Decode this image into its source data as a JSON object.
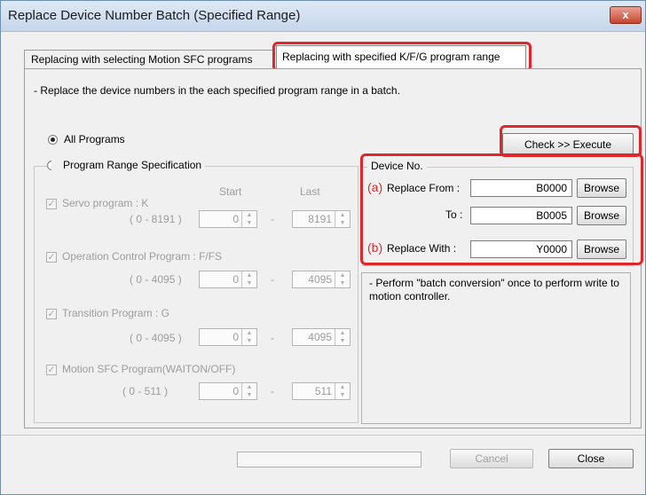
{
  "window": {
    "title": "Replace Device Number Batch (Specified Range)",
    "close_glyph": "x"
  },
  "tabs": [
    {
      "label": "Replacing with selecting Motion SFC programs"
    },
    {
      "label": "Replacing with specified K/F/G program range"
    }
  ],
  "description": "- Replace the device numbers in the each specified program range in a batch.",
  "options": {
    "all_programs": "All Programs",
    "range_spec": "Program Range Specification"
  },
  "range": {
    "start_header": "Start",
    "last_header": "Last",
    "dash": "-",
    "items": [
      {
        "label": "Servo program : K",
        "range": "( 0 - 8191 )",
        "start": "0",
        "last": "8191"
      },
      {
        "label": "Operation Control Program : F/FS",
        "range": "( 0 - 4095 )",
        "start": "0",
        "last": "4095"
      },
      {
        "label": "Transition Program : G",
        "range": "( 0 - 4095 )",
        "start": "0",
        "last": "4095"
      },
      {
        "label": "Motion SFC Program(WAITON/OFF)",
        "range": "( 0 - 511 )",
        "start": "0",
        "last": "511"
      }
    ]
  },
  "execute_button": "Check >> Execute",
  "device": {
    "group_label": "Device No.",
    "marker_a": "(a)",
    "marker_b": "(b)",
    "replace_from_label": "Replace From :",
    "replace_from_value": "B0000",
    "to_label": "To :",
    "to_value": "B0005",
    "replace_with_label": "Replace With :",
    "replace_with_value": "Y0000",
    "browse": "Browse"
  },
  "note": "- Perform \"batch conversion\" once to perform write to motion controller.",
  "footer": {
    "cancel": "Cancel",
    "close": "Close"
  },
  "colors": {
    "highlight": "#e0262b",
    "disabled_text": "#9c9c9c"
  }
}
